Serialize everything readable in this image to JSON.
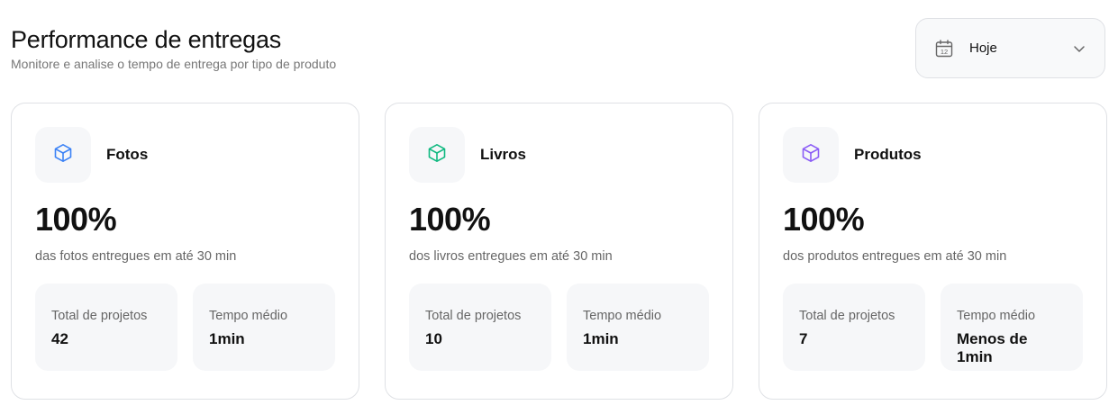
{
  "header": {
    "title": "Performance de entregas",
    "subtitle": "Monitore e analise o tempo de entrega por tipo de produto"
  },
  "date_filter": {
    "selected": "Hoje",
    "icon": "calendar-icon",
    "calendar_day": "12"
  },
  "colors": {
    "fotos": "#3b82f6",
    "livros": "#10b981",
    "produtos": "#8b5cf6"
  },
  "cards": [
    {
      "title": "Fotos",
      "icon": "box-icon",
      "percent": "100%",
      "description": "das fotos entregues em até 30 min",
      "total_label": "Total de projetos",
      "total_value": "42",
      "avg_label": "Tempo médio",
      "avg_value": "1min"
    },
    {
      "title": "Livros",
      "icon": "box-icon",
      "percent": "100%",
      "description": "dos livros entregues em até 30 min",
      "total_label": "Total de projetos",
      "total_value": "10",
      "avg_label": "Tempo médio",
      "avg_value": "1min"
    },
    {
      "title": "Produtos",
      "icon": "box-icon",
      "percent": "100%",
      "description": "dos produtos entregues em até 30 min",
      "total_label": "Total de projetos",
      "total_value": "7",
      "avg_label": "Tempo médio",
      "avg_value": "Menos de 1min"
    }
  ]
}
